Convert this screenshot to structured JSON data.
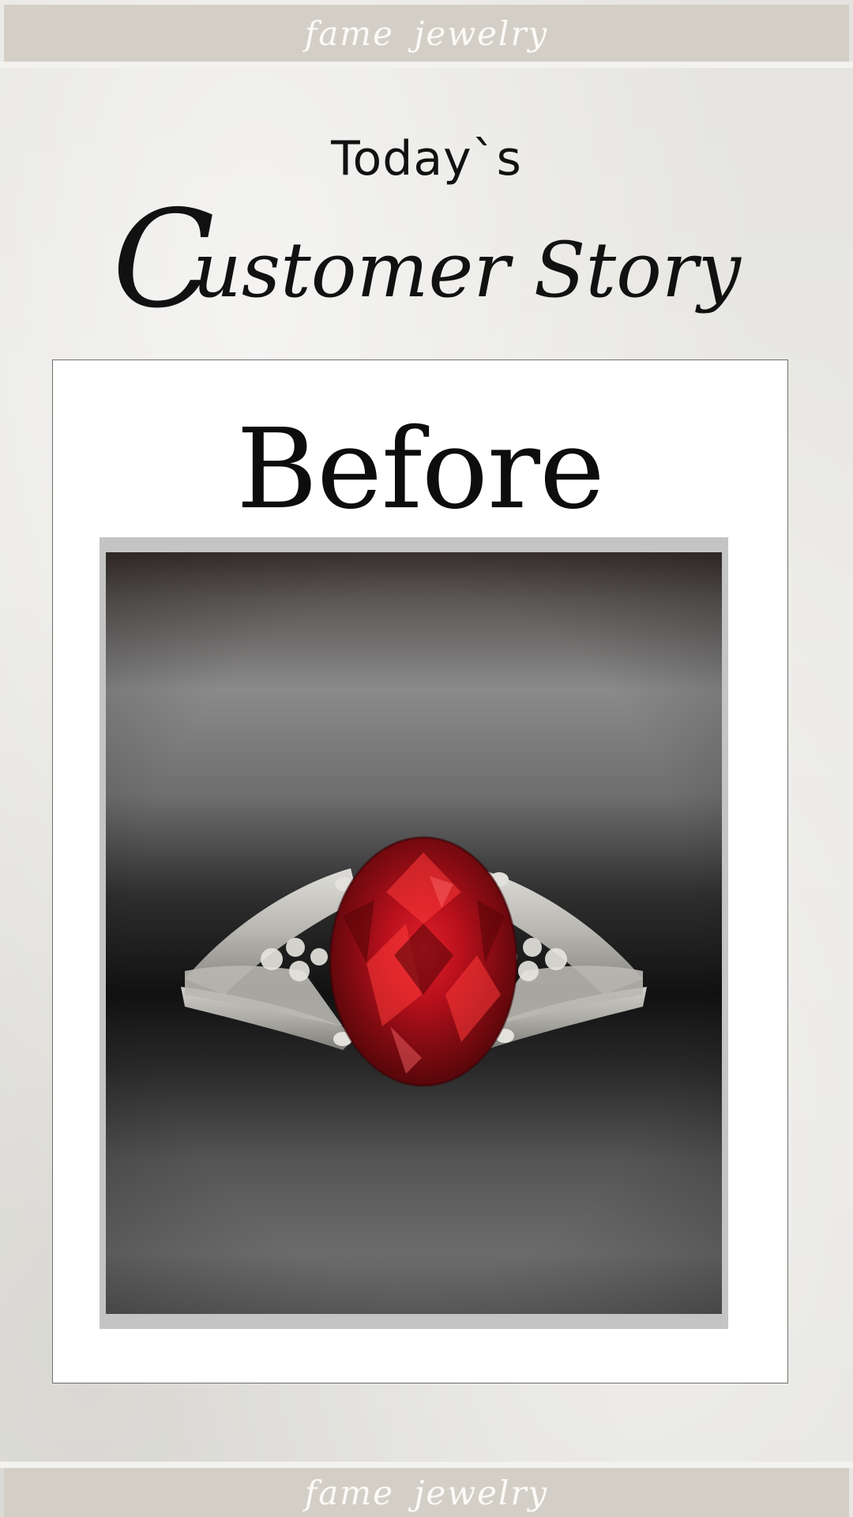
{
  "header": {
    "brand": "fame jewelry"
  },
  "hero": {
    "todays": "Today`s",
    "title_initial": "C",
    "title_rest": "ustomer Story"
  },
  "card": {
    "label": "Before",
    "photo_subject": "red oval gemstone ring"
  },
  "footer": {
    "brand": "fame jewelry"
  },
  "colors": {
    "brand_bar": "#d3cfc6",
    "brand_text": "#fbfaf6",
    "gem": "#b01018",
    "metal": "#d8d8d4"
  }
}
